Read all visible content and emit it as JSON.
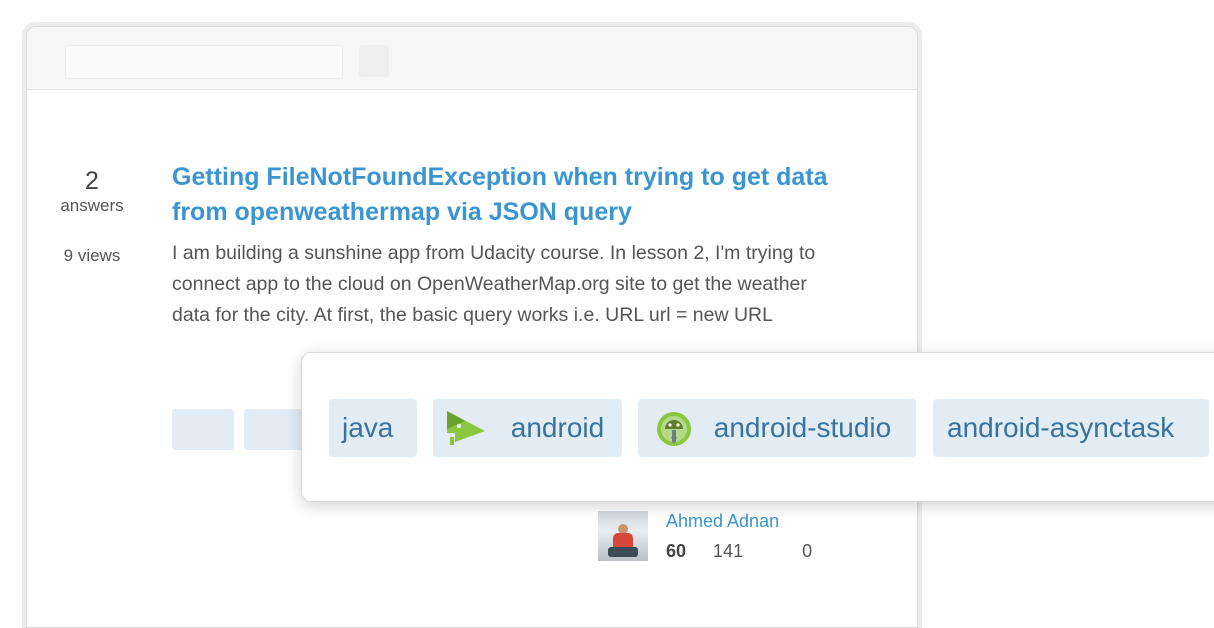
{
  "question": {
    "votes_or_answers": "2",
    "answers_label": "answers",
    "views": "9 views",
    "title": "Getting FileNotFoundException when trying to get data from openweathermap via JSON query",
    "excerpt": "I am building a sunshine app from Udacity course. In lesson 2, I'm trying to connect app to the cloud on OpenWeatherMap.org site to get the weather data for the city.  At first, the basic query works i.e. URL url = new URL"
  },
  "tags_popup": {
    "tags": [
      {
        "label": "java",
        "icon": ""
      },
      {
        "label": "android",
        "icon": "android-robot-icon"
      },
      {
        "label": "android-studio",
        "icon": "android-studio-icon"
      },
      {
        "label": "android-asynctask",
        "icon": ""
      }
    ]
  },
  "user": {
    "name": "Ahmed Adnan",
    "reputation": "60",
    "badge_count_1": "141",
    "badge_count_2": "0"
  },
  "colors": {
    "link": "#3a95d0",
    "tag_bg": "#e1ecf4",
    "tag_text": "#39739d"
  }
}
